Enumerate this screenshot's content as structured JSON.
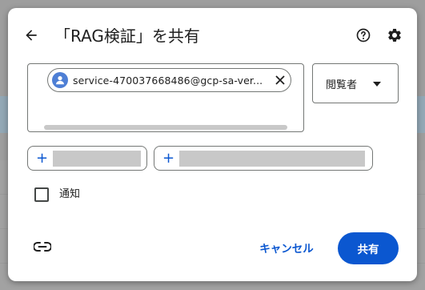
{
  "dialog": {
    "title": "「RAG検証」を共有",
    "icons": {
      "back": "arrow-back-icon",
      "help": "help-circle-icon",
      "settings": "gear-icon",
      "link": "link-icon",
      "avatar": "person-avatar-icon",
      "remove": "close-icon",
      "caret": "caret-down-icon",
      "add": "plus-icon"
    }
  },
  "recipients": {
    "chip_email": "service-470037668486@gcp-sa-ver..."
  },
  "role": {
    "selected": "閲覧者"
  },
  "add_buttons": [
    {
      "plus": "+"
    },
    {
      "plus": "+"
    }
  ],
  "notify": {
    "label": "通知",
    "checked": false
  },
  "actions": {
    "cancel": "キャンセル",
    "share": "共有"
  },
  "colors": {
    "primary": "#0b57d0",
    "avatar": "#4e7fd5",
    "text": "#1f1f1f"
  }
}
